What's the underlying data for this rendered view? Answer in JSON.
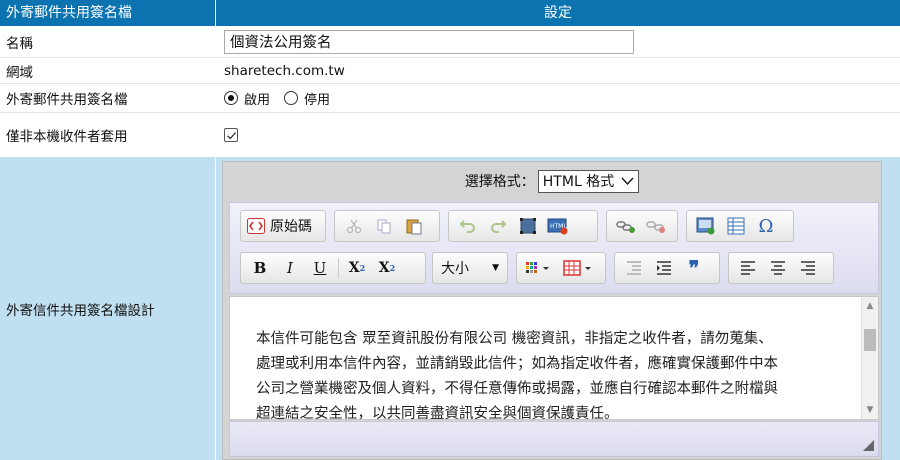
{
  "header": {
    "col1": "外寄郵件共用簽名檔",
    "col2": "設定"
  },
  "rows": {
    "name": {
      "label": "名稱",
      "value": "個資法公用簽名"
    },
    "domain": {
      "label": "網域",
      "value": "sharetech.com.tw"
    },
    "enable": {
      "label": "外寄郵件共用簽名檔",
      "on": "啟用",
      "off": "停用",
      "selected": "啟用"
    },
    "nonlocal": {
      "label": "僅非本機收件者套用",
      "checked": true
    }
  },
  "design": {
    "label": "外寄信件共用簽名檔設計",
    "format_label": "選擇格式：",
    "format_value": "HTML 格式",
    "toolbar": {
      "source_label": "原始碼",
      "size_label": "大小",
      "icons": [
        "source-icon",
        "cut-icon",
        "copy-icon",
        "paste-icon",
        "undo-icon",
        "redo-icon",
        "select-all-icon",
        "html-snippet-icon",
        "link-icon",
        "unlink-icon",
        "image-icon",
        "table-icon",
        "special-char-icon",
        "bold-icon",
        "italic-icon",
        "underline-icon",
        "subscript-icon",
        "superscript-icon",
        "font-size-select",
        "text-color-icon",
        "background-color-icon",
        "outdent-icon",
        "indent-icon",
        "blockquote-icon",
        "align-left-icon",
        "align-center-icon",
        "align-right-icon"
      ]
    },
    "content": {
      "line1": "本信件可能包含 眾至資訊股份有限公司 機密資訊，非指定之收件者，請勿蒐集、",
      "line2": "處理或利用本信件內容，並請銷毀此信件；如為指定收件者，應確實保護郵件中本",
      "line3": "公司之營業機密及個人資料，不得任意傳佈或揭露，並應自行確認本郵件之附檔與",
      "line4": "超連結之安全性，以共同善盡資訊安全與個資保護責任。"
    }
  }
}
